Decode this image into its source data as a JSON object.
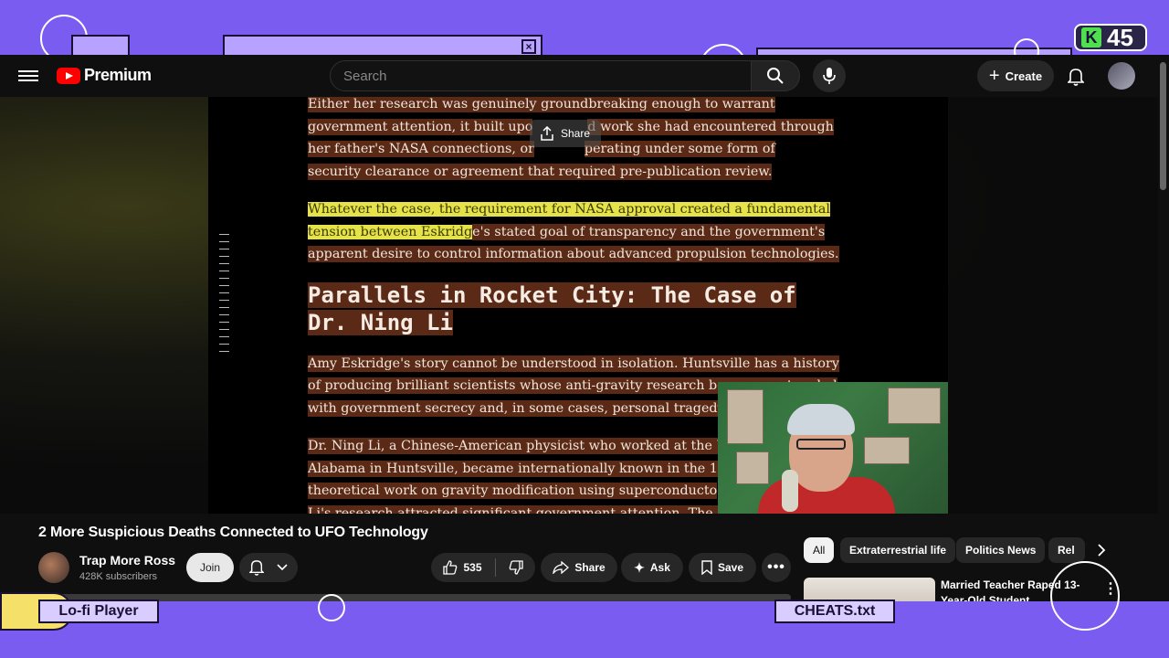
{
  "desktop": {
    "badge_text": "45",
    "badge_letter": "K",
    "labels": {
      "lofi": "Lo-fi Player",
      "cheats": "CHEATS.txt"
    }
  },
  "header": {
    "logo_text": "Premium",
    "search_placeholder": "Search",
    "create_label": "Create"
  },
  "video": {
    "share_label": "Share",
    "article": {
      "p1_lines": [
        "Either her research was genuinely groundbreaking enough to warrant",
        "government attention, it built upo",
        "d work she had encountered through",
        "her father's NASA connections, or",
        "perating under some form of",
        "security clearance or agreement that required pre-publication review."
      ],
      "p2_highlight_a": "Whatever the case, the requirement for NASA approval created a fundamental",
      "p2_highlight_b": "tension between Eskridg",
      "p2_rest_b": "e's stated goal of transparency and the government's",
      "p2_line3": "apparent desire to control information about advanced propulsion technologies.",
      "heading_line1": "Parallels in Rocket City: The Case of",
      "heading_line2": "Dr. Ning Li",
      "p3_lines": [
        "Amy Eskridge's story cannot be understood in isolation. Huntsville has a history",
        "of producing brilliant scientists whose anti-gravity research becomes entangled",
        "with government secrecy and, in some cases, personal tragedy"
      ],
      "p4_lines": [
        "Dr. Ning Li, a Chinese-American physicist who worked at the U",
        "Alabama in Huntsville, became internationally known in the 1",
        "theoretical work on gravity modification using superconducto",
        "Li's research attracted significant government attention. The L"
      ]
    }
  },
  "meta": {
    "title": "2 More Suspicious Deaths Connected to UFO Technology",
    "channel_name": "Trap More Ross",
    "subscribers": "428K subscribers",
    "join_label": "Join",
    "like_count": "535",
    "share_label": "Share",
    "ask_label": "Ask",
    "save_label": "Save"
  },
  "chips": [
    "All",
    "Extraterrestrial life",
    "Politics News",
    "Rel"
  ],
  "recommendation": {
    "title": "Married Teacher Raped 13-Year-Old Student"
  },
  "colors": {
    "desktop_bg": "#7b5cf0",
    "yt_bg": "#0f0f0f",
    "highlight_brown": "#5a2a16",
    "highlight_yellow": "#e6e34a",
    "youtube_red": "#ff0000"
  }
}
